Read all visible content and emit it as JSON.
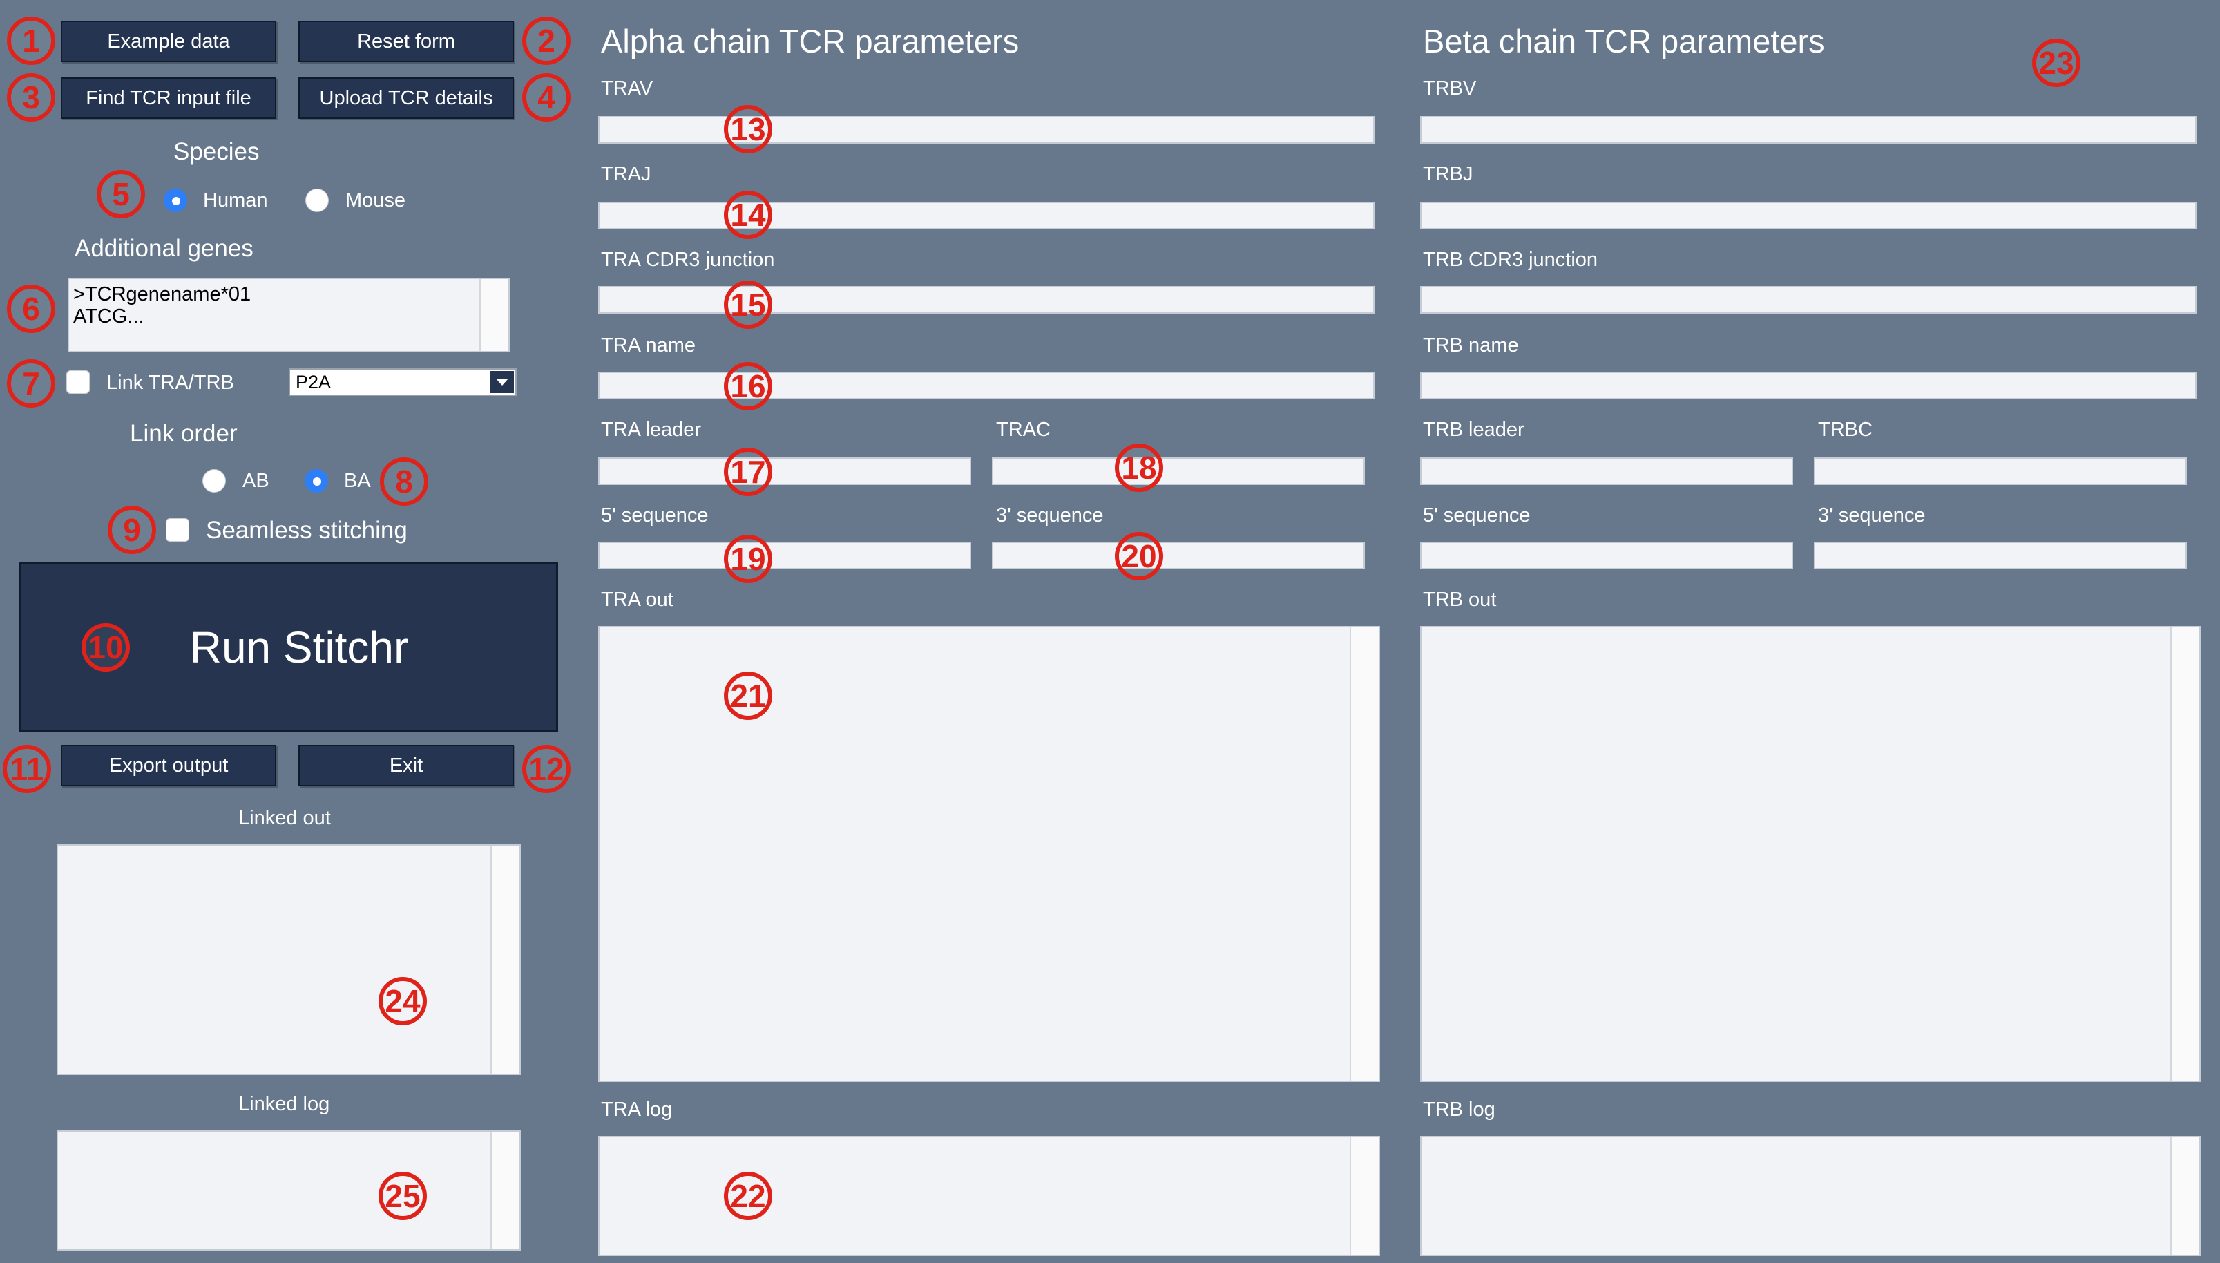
{
  "colors": {
    "background": "#67788c",
    "button": "#243451",
    "accent": "#e0231a",
    "radio_on": "#2d7ff9"
  },
  "left": {
    "buttons": {
      "example": "Example data",
      "reset": "Reset form",
      "find_tcr": "Find TCR input file",
      "upload_tcr": "Upload TCR details",
      "run": "Run Stitchr",
      "export": "Export output",
      "exit": "Exit"
    },
    "species": {
      "label": "Species",
      "human": "Human",
      "mouse": "Mouse",
      "selected": "Human"
    },
    "additional_genes": {
      "label": "Additional genes",
      "line1": ">TCRgenename*01",
      "line2": "ATCG..."
    },
    "link": {
      "label": "Link TRA/TRB",
      "option": "P2A"
    },
    "link_order": {
      "label": "Link order",
      "ab": "AB",
      "ba": "BA",
      "selected": "BA"
    },
    "seamless": "Seamless stitching",
    "linked_out": "Linked out",
    "linked_log": "Linked log"
  },
  "alpha": {
    "heading": "Alpha chain TCR parameters",
    "v": "TRAV",
    "j": "TRAJ",
    "cdr3": "TRA CDR3 junction",
    "name": "TRA name",
    "leader": "TRA leader",
    "c": "TRAC",
    "five": "5' sequence",
    "three": "3' sequence",
    "out": "TRA out",
    "log": "TRA log"
  },
  "beta": {
    "heading": "Beta chain TCR parameters",
    "v": "TRBV",
    "j": "TRBJ",
    "cdr3": "TRB CDR3 junction",
    "name": "TRB name",
    "leader": "TRB leader",
    "c": "TRBC",
    "five": "5' sequence",
    "three": "3' sequence",
    "out": "TRB out",
    "log": "TRB log"
  },
  "annotations": [
    "1",
    "2",
    "3",
    "4",
    "5",
    "6",
    "7",
    "8",
    "9",
    "10",
    "11",
    "12",
    "13",
    "14",
    "15",
    "16",
    "17",
    "18",
    "19",
    "20",
    "21",
    "22",
    "23",
    "24",
    "25"
  ]
}
